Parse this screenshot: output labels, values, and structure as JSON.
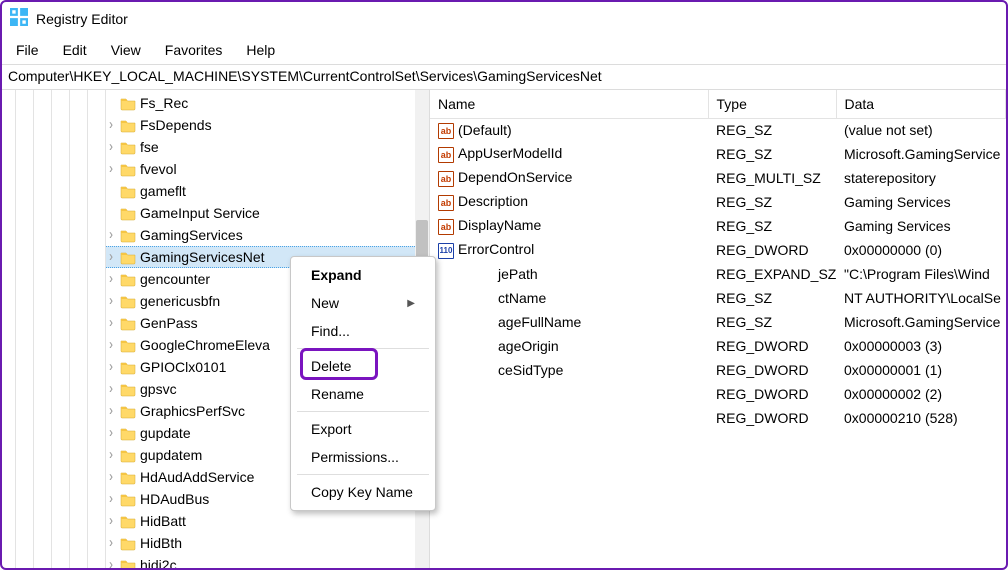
{
  "title": "Registry Editor",
  "menu": [
    "File",
    "Edit",
    "View",
    "Favorites",
    "Help"
  ],
  "address": "Computer\\HKEY_LOCAL_MACHINE\\SYSTEM\\CurrentControlSet\\Services\\GamingServicesNet",
  "tree": [
    {
      "label": "Fs_Rec",
      "exp": false
    },
    {
      "label": "FsDepends",
      "exp": true
    },
    {
      "label": "fse",
      "exp": true
    },
    {
      "label": "fvevol",
      "exp": true
    },
    {
      "label": "gameflt",
      "exp": false
    },
    {
      "label": "GameInput Service",
      "exp": false
    },
    {
      "label": "GamingServices",
      "exp": true
    },
    {
      "label": "GamingServicesNet",
      "exp": true,
      "selected": true
    },
    {
      "label": "gencounter",
      "exp": true
    },
    {
      "label": "genericusbfn",
      "exp": true
    },
    {
      "label": "GenPass",
      "exp": true
    },
    {
      "label": "GoogleChromeEleva",
      "exp": true
    },
    {
      "label": "GPIOClx0101",
      "exp": true
    },
    {
      "label": "gpsvc",
      "exp": true
    },
    {
      "label": "GraphicsPerfSvc",
      "exp": true
    },
    {
      "label": "gupdate",
      "exp": true
    },
    {
      "label": "gupdatem",
      "exp": true
    },
    {
      "label": "HdAudAddService",
      "exp": true
    },
    {
      "label": "HDAudBus",
      "exp": true
    },
    {
      "label": "HidBatt",
      "exp": true
    },
    {
      "label": "HidBth",
      "exp": true
    },
    {
      "label": "hidi2c",
      "exp": true
    }
  ],
  "columns": {
    "name": "Name",
    "type": "Type",
    "data": "Data"
  },
  "rows": [
    {
      "icon": "str",
      "name": "(Default)",
      "type": "REG_SZ",
      "data": "(value not set)"
    },
    {
      "icon": "str",
      "name": "AppUserModelId",
      "type": "REG_SZ",
      "data": "Microsoft.GamingService"
    },
    {
      "icon": "str",
      "name": "DependOnService",
      "type": "REG_MULTI_SZ",
      "data": "staterepository"
    },
    {
      "icon": "str",
      "name": "Description",
      "type": "REG_SZ",
      "data": "Gaming Services"
    },
    {
      "icon": "str",
      "name": "DisplayName",
      "type": "REG_SZ",
      "data": "Gaming Services"
    },
    {
      "icon": "dw",
      "name": "ErrorControl",
      "type": "REG_DWORD",
      "data": "0x00000000 (0)"
    },
    {
      "icon": "str",
      "name": "ImagePath",
      "type": "REG_EXPAND_SZ",
      "data": "\"C:\\Program Files\\Wind",
      "cov": "jePath"
    },
    {
      "icon": "str",
      "name": "ObjectName",
      "type": "REG_SZ",
      "data": "NT AUTHORITY\\LocalSe",
      "cov": "ctName"
    },
    {
      "icon": "str",
      "name": "PackageFullName",
      "type": "REG_SZ",
      "data": "Microsoft.GamingService",
      "cov": "ageFullName"
    },
    {
      "icon": "dw",
      "name": "PackageOrigin",
      "type": "REG_DWORD",
      "data": "0x00000003 (3)",
      "cov": "ageOrigin"
    },
    {
      "icon": "dw",
      "name": "ServiceSidType",
      "type": "REG_DWORD",
      "data": "0x00000001 (1)",
      "cov": "ceSidType"
    },
    {
      "icon": "dw",
      "name": "",
      "type": "REG_DWORD",
      "data": "0x00000002 (2)"
    },
    {
      "icon": "dw",
      "name": "",
      "type": "REG_DWORD",
      "data": "0x00000210 (528)"
    }
  ],
  "ctx": {
    "expand": "Expand",
    "new": "New",
    "find": "Find...",
    "delete": "Delete",
    "rename": "Rename",
    "export": "Export",
    "permissions": "Permissions...",
    "copy": "Copy Key Name"
  }
}
